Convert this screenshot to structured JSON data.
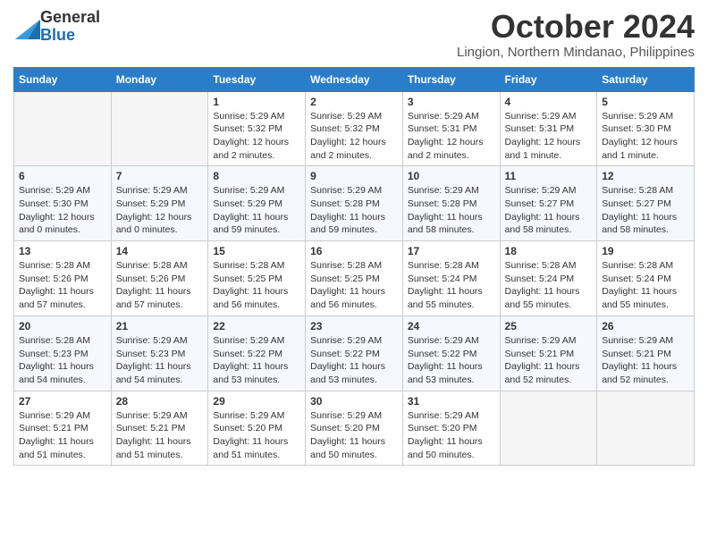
{
  "logo": {
    "general": "General",
    "blue": "Blue"
  },
  "header": {
    "month": "October 2024",
    "location": "Lingion, Northern Mindanao, Philippines"
  },
  "days_of_week": [
    "Sunday",
    "Monday",
    "Tuesday",
    "Wednesday",
    "Thursday",
    "Friday",
    "Saturday"
  ],
  "weeks": [
    [
      {
        "day": "",
        "detail": ""
      },
      {
        "day": "",
        "detail": ""
      },
      {
        "day": "1",
        "detail": "Sunrise: 5:29 AM\nSunset: 5:32 PM\nDaylight: 12 hours and 2 minutes."
      },
      {
        "day": "2",
        "detail": "Sunrise: 5:29 AM\nSunset: 5:32 PM\nDaylight: 12 hours and 2 minutes."
      },
      {
        "day": "3",
        "detail": "Sunrise: 5:29 AM\nSunset: 5:31 PM\nDaylight: 12 hours and 2 minutes."
      },
      {
        "day": "4",
        "detail": "Sunrise: 5:29 AM\nSunset: 5:31 PM\nDaylight: 12 hours and 1 minute."
      },
      {
        "day": "5",
        "detail": "Sunrise: 5:29 AM\nSunset: 5:30 PM\nDaylight: 12 hours and 1 minute."
      }
    ],
    [
      {
        "day": "6",
        "detail": "Sunrise: 5:29 AM\nSunset: 5:30 PM\nDaylight: 12 hours and 0 minutes."
      },
      {
        "day": "7",
        "detail": "Sunrise: 5:29 AM\nSunset: 5:29 PM\nDaylight: 12 hours and 0 minutes."
      },
      {
        "day": "8",
        "detail": "Sunrise: 5:29 AM\nSunset: 5:29 PM\nDaylight: 11 hours and 59 minutes."
      },
      {
        "day": "9",
        "detail": "Sunrise: 5:29 AM\nSunset: 5:28 PM\nDaylight: 11 hours and 59 minutes."
      },
      {
        "day": "10",
        "detail": "Sunrise: 5:29 AM\nSunset: 5:28 PM\nDaylight: 11 hours and 58 minutes."
      },
      {
        "day": "11",
        "detail": "Sunrise: 5:29 AM\nSunset: 5:27 PM\nDaylight: 11 hours and 58 minutes."
      },
      {
        "day": "12",
        "detail": "Sunrise: 5:28 AM\nSunset: 5:27 PM\nDaylight: 11 hours and 58 minutes."
      }
    ],
    [
      {
        "day": "13",
        "detail": "Sunrise: 5:28 AM\nSunset: 5:26 PM\nDaylight: 11 hours and 57 minutes."
      },
      {
        "day": "14",
        "detail": "Sunrise: 5:28 AM\nSunset: 5:26 PM\nDaylight: 11 hours and 57 minutes."
      },
      {
        "day": "15",
        "detail": "Sunrise: 5:28 AM\nSunset: 5:25 PM\nDaylight: 11 hours and 56 minutes."
      },
      {
        "day": "16",
        "detail": "Sunrise: 5:28 AM\nSunset: 5:25 PM\nDaylight: 11 hours and 56 minutes."
      },
      {
        "day": "17",
        "detail": "Sunrise: 5:28 AM\nSunset: 5:24 PM\nDaylight: 11 hours and 55 minutes."
      },
      {
        "day": "18",
        "detail": "Sunrise: 5:28 AM\nSunset: 5:24 PM\nDaylight: 11 hours and 55 minutes."
      },
      {
        "day": "19",
        "detail": "Sunrise: 5:28 AM\nSunset: 5:24 PM\nDaylight: 11 hours and 55 minutes."
      }
    ],
    [
      {
        "day": "20",
        "detail": "Sunrise: 5:28 AM\nSunset: 5:23 PM\nDaylight: 11 hours and 54 minutes."
      },
      {
        "day": "21",
        "detail": "Sunrise: 5:29 AM\nSunset: 5:23 PM\nDaylight: 11 hours and 54 minutes."
      },
      {
        "day": "22",
        "detail": "Sunrise: 5:29 AM\nSunset: 5:22 PM\nDaylight: 11 hours and 53 minutes."
      },
      {
        "day": "23",
        "detail": "Sunrise: 5:29 AM\nSunset: 5:22 PM\nDaylight: 11 hours and 53 minutes."
      },
      {
        "day": "24",
        "detail": "Sunrise: 5:29 AM\nSunset: 5:22 PM\nDaylight: 11 hours and 53 minutes."
      },
      {
        "day": "25",
        "detail": "Sunrise: 5:29 AM\nSunset: 5:21 PM\nDaylight: 11 hours and 52 minutes."
      },
      {
        "day": "26",
        "detail": "Sunrise: 5:29 AM\nSunset: 5:21 PM\nDaylight: 11 hours and 52 minutes."
      }
    ],
    [
      {
        "day": "27",
        "detail": "Sunrise: 5:29 AM\nSunset: 5:21 PM\nDaylight: 11 hours and 51 minutes."
      },
      {
        "day": "28",
        "detail": "Sunrise: 5:29 AM\nSunset: 5:21 PM\nDaylight: 11 hours and 51 minutes."
      },
      {
        "day": "29",
        "detail": "Sunrise: 5:29 AM\nSunset: 5:20 PM\nDaylight: 11 hours and 51 minutes."
      },
      {
        "day": "30",
        "detail": "Sunrise: 5:29 AM\nSunset: 5:20 PM\nDaylight: 11 hours and 50 minutes."
      },
      {
        "day": "31",
        "detail": "Sunrise: 5:29 AM\nSunset: 5:20 PM\nDaylight: 11 hours and 50 minutes."
      },
      {
        "day": "",
        "detail": ""
      },
      {
        "day": "",
        "detail": ""
      }
    ]
  ]
}
